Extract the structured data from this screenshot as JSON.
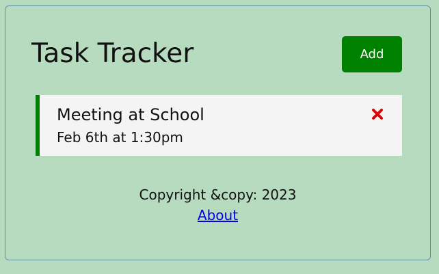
{
  "header": {
    "title": "Task Tracker",
    "add_button_label": "Add"
  },
  "tasks": [
    {
      "title": "Meeting at School",
      "time": "Feb 6th at 1:30pm",
      "reminder": true,
      "delete_icon": "close-icon"
    }
  ],
  "footer": {
    "copyright": "Copyright &copy: 2023",
    "about_link": "About"
  },
  "colors": {
    "background": "#b7dbbf",
    "accent": "#008000",
    "delete": "#e00000",
    "task_background": "#f4f4f4"
  }
}
